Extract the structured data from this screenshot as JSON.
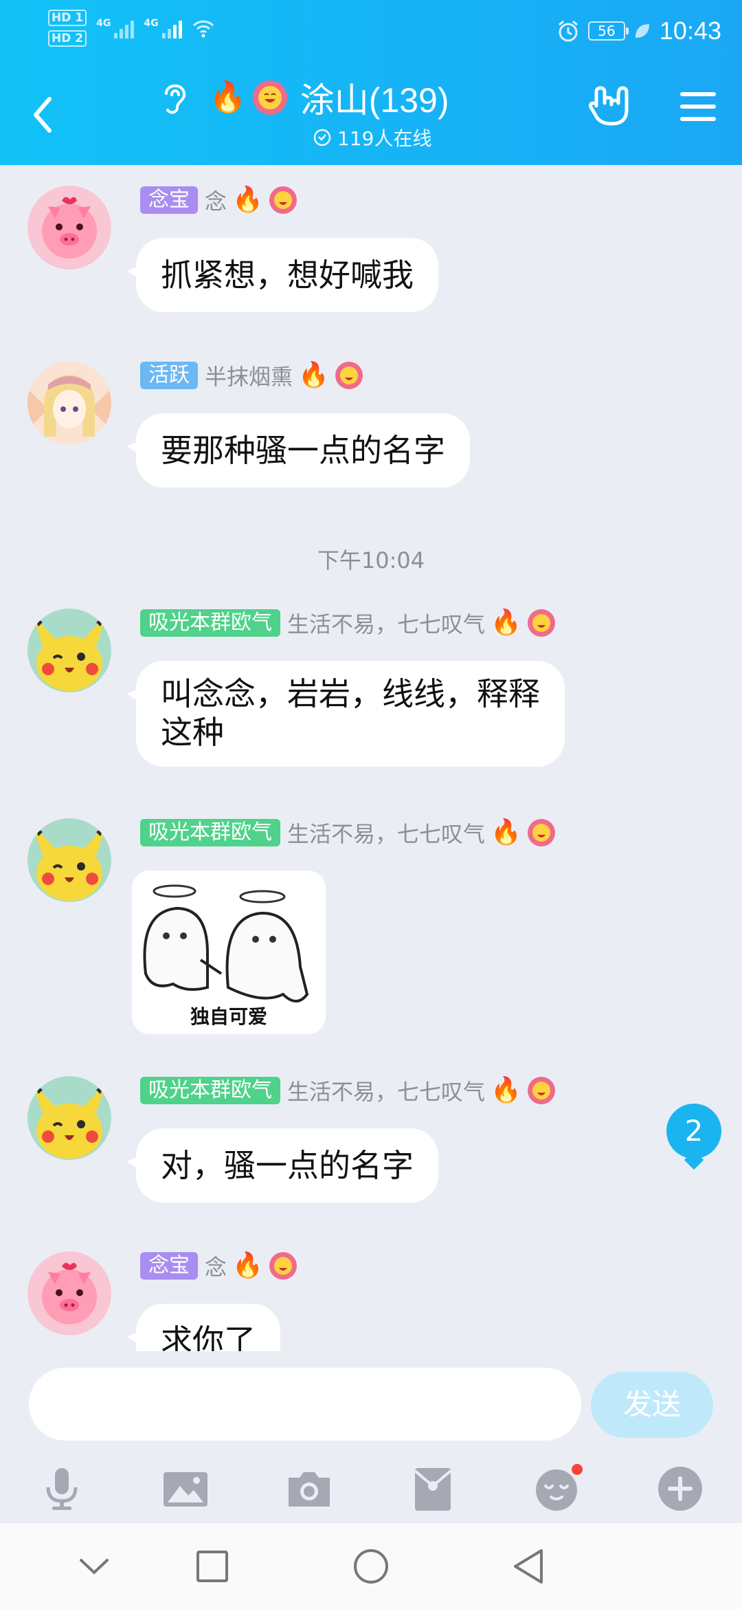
{
  "status_bar": {
    "hd1": "HD 1",
    "hd2": "HD 2",
    "net1": "4G",
    "net2": "4G",
    "battery": "56",
    "time": "10:43"
  },
  "header": {
    "group_title": "涂山(139)",
    "online": "119人在线"
  },
  "messages": [
    {
      "tag": "念宝",
      "nick": "念",
      "text": "抓紧想，想好喊我"
    },
    {
      "tag": "活跃",
      "nick": "半抹烟熏",
      "text": "要那种骚一点的名字"
    },
    {
      "tag": "吸光本群欧气",
      "nick": "生活不易，七七叹气",
      "text_line1": "叫念念，岩岩，线线，释释",
      "text_line2": "这种"
    },
    {
      "tag": "吸光本群欧气",
      "nick": "生活不易，七七叹气",
      "image_caption": "独自可爱"
    },
    {
      "tag": "吸光本群欧气",
      "nick": "生活不易，七七叹气",
      "text": "对，骚一点的名字"
    },
    {
      "tag": "念宝",
      "nick": "念",
      "text": "求你了"
    }
  ],
  "time_divider": "下午10:04",
  "unread_count": "2",
  "input": {
    "placeholder": "",
    "send_label": "发送"
  },
  "toolbar_icons": [
    "microphone-icon",
    "image-icon",
    "camera-icon",
    "red-packet-icon",
    "emoji-icon",
    "plus-icon"
  ],
  "colors": {
    "header_start": "#12c2f7",
    "header_end": "#1aa8f5",
    "tag_purple": "#a98df0",
    "tag_blue": "#6cb8f2",
    "tag_green": "#4fd28a",
    "chat_bg": "#ebedf5"
  }
}
